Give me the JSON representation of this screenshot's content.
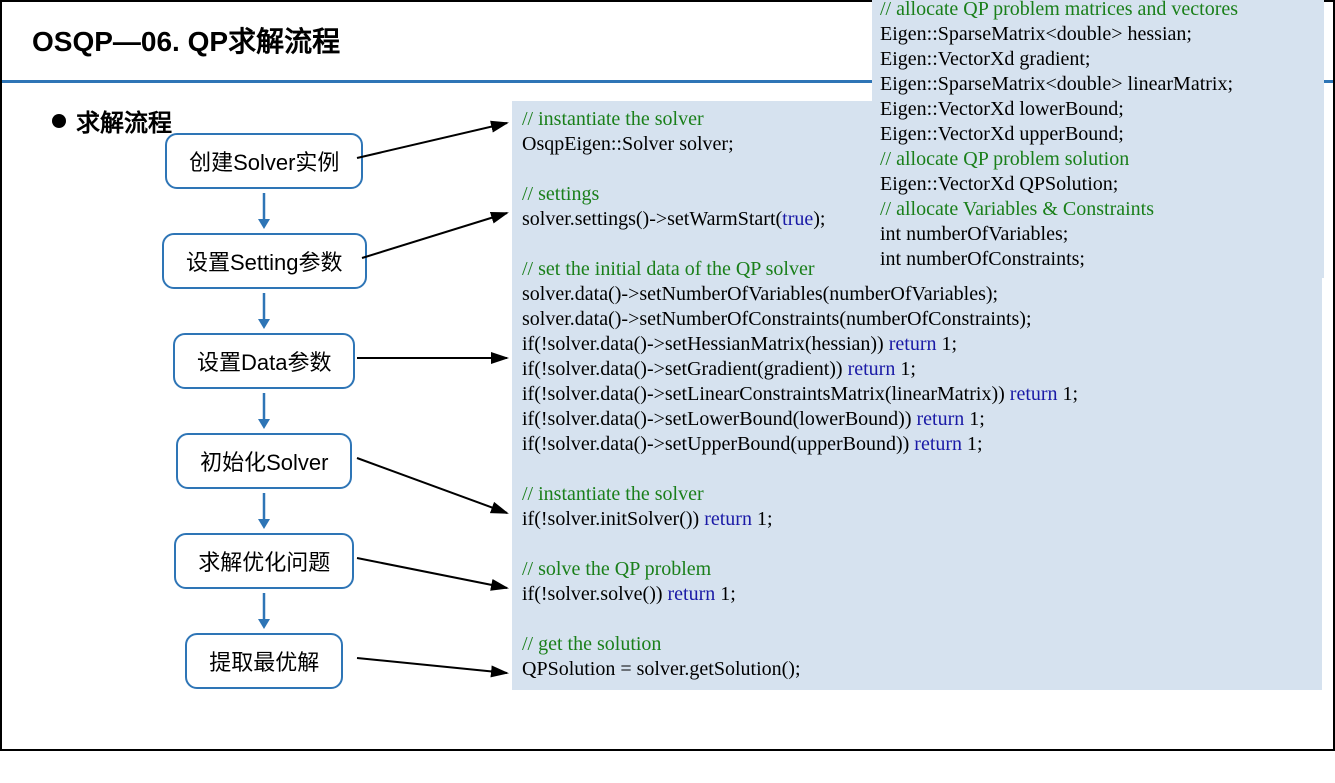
{
  "title": "OSQP—06. QP求解流程",
  "sectionLabel": "求解流程",
  "flow": {
    "step1": "创建Solver实例",
    "step2": "设置Setting参数",
    "step3": "设置Data参数",
    "step4": "初始化Solver",
    "step5": "求解优化问题",
    "step6": "提取最优解"
  },
  "codeTop": {
    "c1": "// allocate QP problem matrices and vectores",
    "l1": "Eigen::SparseMatrix<double> hessian;",
    "l2": "Eigen::VectorXd gradient;",
    "l3": "Eigen::SparseMatrix<double> linearMatrix;",
    "l4": "Eigen::VectorXd lowerBound;",
    "l5": "Eigen::VectorXd upperBound;",
    "c2": "// allocate QP problem solution",
    "l6": "Eigen::VectorXd QPSolution;",
    "c3": "// allocate Variables & Constraints",
    "l7": "int numberOfVariables;",
    "l8": "int numberOfConstraints;"
  },
  "codeMain": {
    "c1": "// instantiate the solver",
    "l1": "OsqpEigen::Solver solver;",
    "c2": "// settings",
    "l2a": "solver.settings()->setWarmStart(",
    "l2true": "true",
    "l2b": ");",
    "c3": "// set the initial data of the QP solver",
    "l3": "solver.data()->setNumberOfVariables(numberOfVariables);",
    "l4": "solver.data()->setNumberOfConstraints(numberOfConstraints);",
    "l5a": "if(!solver.data()->setHessianMatrix(hessian)) ",
    "ret": "return",
    "one": " 1;",
    "l6a": "if(!solver.data()->setGradient(gradient)) ",
    "l7a": "if(!solver.data()->setLinearConstraintsMatrix(linearMatrix)) ",
    "l8a": "if(!solver.data()->setLowerBound(lowerBound)) ",
    "l9a": "if(!solver.data()->setUpperBound(upperBound)) ",
    "c4": "// instantiate the solver",
    "l10a": "if(!solver.initSolver()) ",
    "c5": "// solve the QP problem",
    "l11a": "if(!solver.solve()) ",
    "c6": "// get the solution",
    "l12": "QPSolution = solver.getSolution();"
  }
}
